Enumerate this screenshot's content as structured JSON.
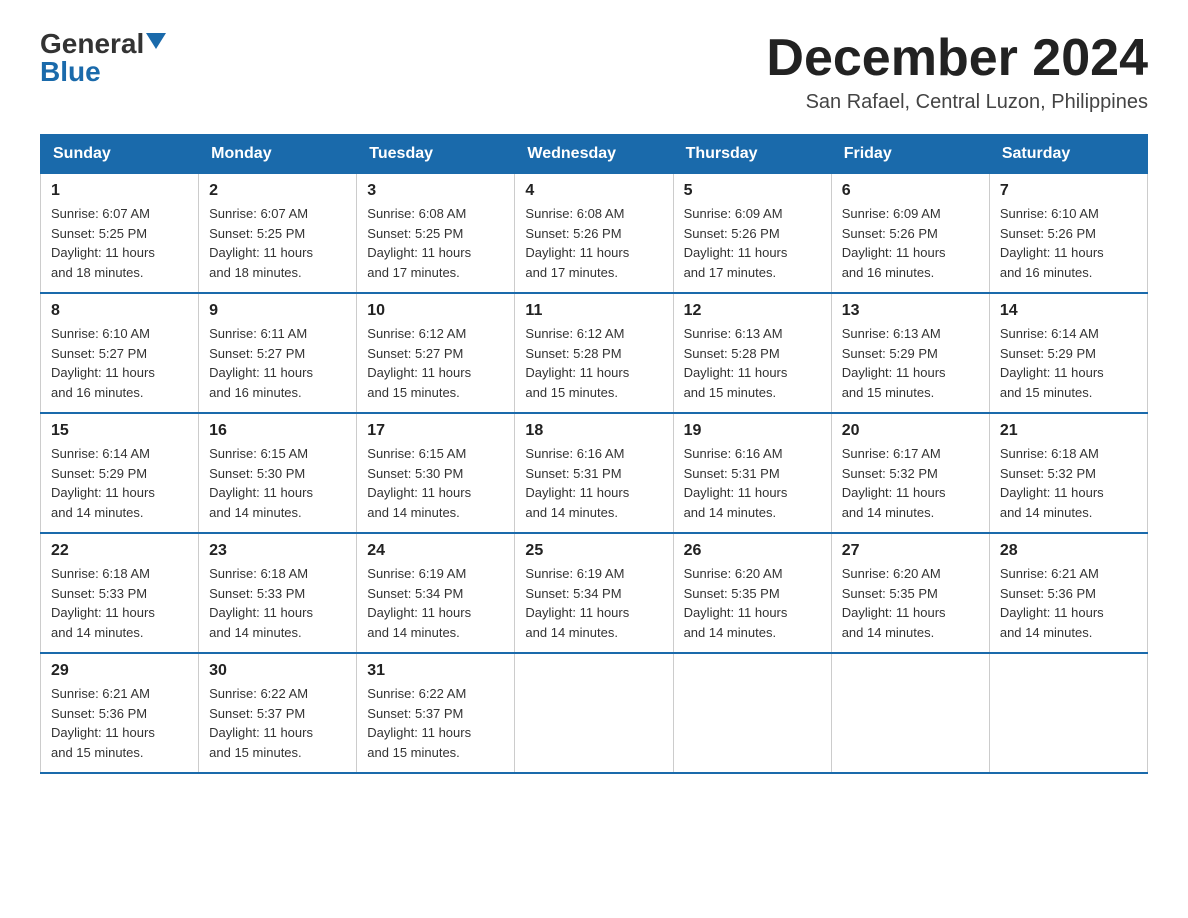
{
  "logo": {
    "general": "General",
    "blue": "Blue"
  },
  "title": {
    "month_year": "December 2024",
    "location": "San Rafael, Central Luzon, Philippines"
  },
  "weekdays": [
    "Sunday",
    "Monday",
    "Tuesday",
    "Wednesday",
    "Thursday",
    "Friday",
    "Saturday"
  ],
  "weeks": [
    [
      {
        "day": "1",
        "sunrise": "6:07 AM",
        "sunset": "5:25 PM",
        "daylight": "11 hours and 18 minutes."
      },
      {
        "day": "2",
        "sunrise": "6:07 AM",
        "sunset": "5:25 PM",
        "daylight": "11 hours and 18 minutes."
      },
      {
        "day": "3",
        "sunrise": "6:08 AM",
        "sunset": "5:25 PM",
        "daylight": "11 hours and 17 minutes."
      },
      {
        "day": "4",
        "sunrise": "6:08 AM",
        "sunset": "5:26 PM",
        "daylight": "11 hours and 17 minutes."
      },
      {
        "day": "5",
        "sunrise": "6:09 AM",
        "sunset": "5:26 PM",
        "daylight": "11 hours and 17 minutes."
      },
      {
        "day": "6",
        "sunrise": "6:09 AM",
        "sunset": "5:26 PM",
        "daylight": "11 hours and 16 minutes."
      },
      {
        "day": "7",
        "sunrise": "6:10 AM",
        "sunset": "5:26 PM",
        "daylight": "11 hours and 16 minutes."
      }
    ],
    [
      {
        "day": "8",
        "sunrise": "6:10 AM",
        "sunset": "5:27 PM",
        "daylight": "11 hours and 16 minutes."
      },
      {
        "day": "9",
        "sunrise": "6:11 AM",
        "sunset": "5:27 PM",
        "daylight": "11 hours and 16 minutes."
      },
      {
        "day": "10",
        "sunrise": "6:12 AM",
        "sunset": "5:27 PM",
        "daylight": "11 hours and 15 minutes."
      },
      {
        "day": "11",
        "sunrise": "6:12 AM",
        "sunset": "5:28 PM",
        "daylight": "11 hours and 15 minutes."
      },
      {
        "day": "12",
        "sunrise": "6:13 AM",
        "sunset": "5:28 PM",
        "daylight": "11 hours and 15 minutes."
      },
      {
        "day": "13",
        "sunrise": "6:13 AM",
        "sunset": "5:29 PM",
        "daylight": "11 hours and 15 minutes."
      },
      {
        "day": "14",
        "sunrise": "6:14 AM",
        "sunset": "5:29 PM",
        "daylight": "11 hours and 15 minutes."
      }
    ],
    [
      {
        "day": "15",
        "sunrise": "6:14 AM",
        "sunset": "5:29 PM",
        "daylight": "11 hours and 14 minutes."
      },
      {
        "day": "16",
        "sunrise": "6:15 AM",
        "sunset": "5:30 PM",
        "daylight": "11 hours and 14 minutes."
      },
      {
        "day": "17",
        "sunrise": "6:15 AM",
        "sunset": "5:30 PM",
        "daylight": "11 hours and 14 minutes."
      },
      {
        "day": "18",
        "sunrise": "6:16 AM",
        "sunset": "5:31 PM",
        "daylight": "11 hours and 14 minutes."
      },
      {
        "day": "19",
        "sunrise": "6:16 AM",
        "sunset": "5:31 PM",
        "daylight": "11 hours and 14 minutes."
      },
      {
        "day": "20",
        "sunrise": "6:17 AM",
        "sunset": "5:32 PM",
        "daylight": "11 hours and 14 minutes."
      },
      {
        "day": "21",
        "sunrise": "6:18 AM",
        "sunset": "5:32 PM",
        "daylight": "11 hours and 14 minutes."
      }
    ],
    [
      {
        "day": "22",
        "sunrise": "6:18 AM",
        "sunset": "5:33 PM",
        "daylight": "11 hours and 14 minutes."
      },
      {
        "day": "23",
        "sunrise": "6:18 AM",
        "sunset": "5:33 PM",
        "daylight": "11 hours and 14 minutes."
      },
      {
        "day": "24",
        "sunrise": "6:19 AM",
        "sunset": "5:34 PM",
        "daylight": "11 hours and 14 minutes."
      },
      {
        "day": "25",
        "sunrise": "6:19 AM",
        "sunset": "5:34 PM",
        "daylight": "11 hours and 14 minutes."
      },
      {
        "day": "26",
        "sunrise": "6:20 AM",
        "sunset": "5:35 PM",
        "daylight": "11 hours and 14 minutes."
      },
      {
        "day": "27",
        "sunrise": "6:20 AM",
        "sunset": "5:35 PM",
        "daylight": "11 hours and 14 minutes."
      },
      {
        "day": "28",
        "sunrise": "6:21 AM",
        "sunset": "5:36 PM",
        "daylight": "11 hours and 14 minutes."
      }
    ],
    [
      {
        "day": "29",
        "sunrise": "6:21 AM",
        "sunset": "5:36 PM",
        "daylight": "11 hours and 15 minutes."
      },
      {
        "day": "30",
        "sunrise": "6:22 AM",
        "sunset": "5:37 PM",
        "daylight": "11 hours and 15 minutes."
      },
      {
        "day": "31",
        "sunrise": "6:22 AM",
        "sunset": "5:37 PM",
        "daylight": "11 hours and 15 minutes."
      },
      null,
      null,
      null,
      null
    ]
  ]
}
